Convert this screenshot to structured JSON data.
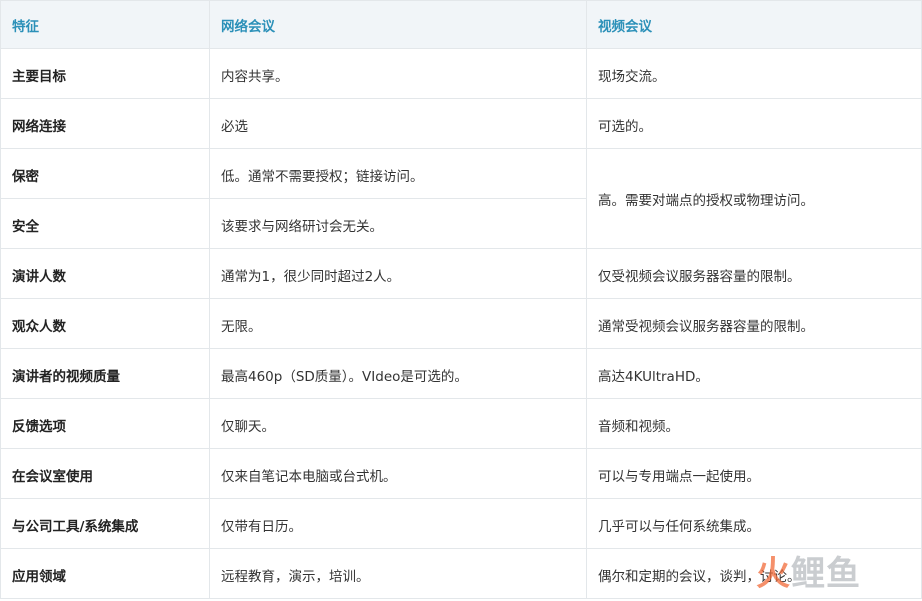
{
  "headers": [
    "特征",
    "网络会议",
    "视频会议"
  ],
  "merged_cell": "高。需要对端点的授权或物理访问。",
  "rows": [
    {
      "feature": "主要目标",
      "web": "内容共享。",
      "video": "现场交流。"
    },
    {
      "feature": "网络连接",
      "web": "必选",
      "video": "可选的。"
    },
    {
      "feature": "保密",
      "web": "低。通常不需要授权；链接访问。"
    },
    {
      "feature": "安全",
      "web": "该要求与网络研讨会无关。"
    },
    {
      "feature": "演讲人数",
      "web": "通常为1，很少同时超过2人。",
      "video": "仅受视频会议服务器容量的限制。"
    },
    {
      "feature": "观众人数",
      "web": "无限。",
      "video": "通常受视频会议服务器容量的限制。"
    },
    {
      "feature": "演讲者的视频质量",
      "web": "最高460p（SD质量）。VIdeo是可选的。",
      "video": "高达4KUltraHD。"
    },
    {
      "feature": "反馈选项",
      "web": "仅聊天。",
      "video": "音频和视频。"
    },
    {
      "feature": "在会议室使用",
      "web": "仅来自笔记本电脑或台式机。",
      "video": "可以与专用端点一起使用。"
    },
    {
      "feature": "与公司工具/系统集成",
      "web": "仅带有日历。",
      "video": "几乎可以与任何系统集成。"
    },
    {
      "feature": "应用领域",
      "web": "远程教育，演示，培训。",
      "video": "偶尔和定期的会议，谈判，讨论。"
    }
  ],
  "watermark": {
    "part1": "火",
    "part2": "鲤鱼",
    "colors": [
      "#f26c3a",
      "#b9bdc1"
    ]
  }
}
